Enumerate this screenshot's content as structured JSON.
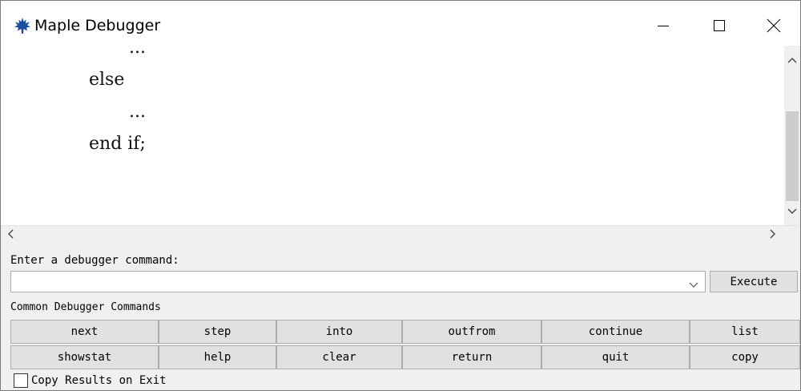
{
  "window": {
    "title": "Maple Debugger"
  },
  "source": {
    "lines": [
      {
        "text": "..."
      },
      {
        "text": "else"
      },
      {
        "text": "..."
      },
      {
        "text": "end if;"
      }
    ]
  },
  "command": {
    "prompt_label": "Enter a debugger command:",
    "input_value": "",
    "execute_label": "Execute"
  },
  "common": {
    "heading": "Common Debugger Commands",
    "buttons": [
      "next",
      "step",
      "into",
      "outfrom",
      "continue",
      "list",
      "showstat",
      "help",
      "clear",
      "return",
      "quit",
      "copy"
    ]
  },
  "options": {
    "copy_results_label": "Copy Results on Exit",
    "copy_results_checked": false
  },
  "icons": {
    "app": "maple-leaf-icon",
    "minimize": "minimize-icon",
    "maximize": "maximize-icon",
    "close": "close-icon",
    "combo": "chevron-down-icon"
  },
  "colors": {
    "app_icon": "#1a4fa0"
  }
}
